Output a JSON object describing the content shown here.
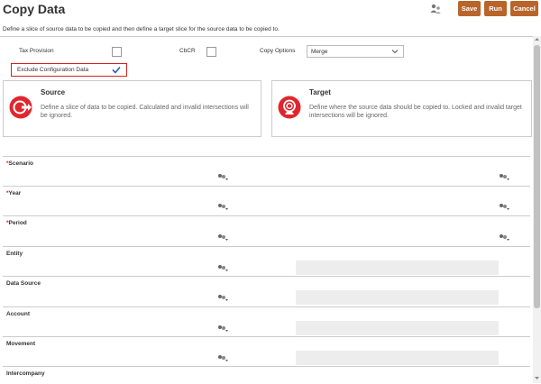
{
  "header": {
    "title": "Copy Data",
    "save_label": "Save",
    "run_label": "Run",
    "cancel_label": "Cancel"
  },
  "description": "Define a slice of source data to be copied and then define a target slice for the source data to be copied to.",
  "options": {
    "tax_provision_label": "Tax Provision",
    "tax_provision_checked": false,
    "cbcr_label": "CbCR",
    "cbcr_checked": false,
    "copy_options_label": "Copy Options",
    "copy_options_value": "Merge",
    "exclude_config_label": "Exclude Configuration Data",
    "exclude_config_checked": true
  },
  "source": {
    "title": "Source",
    "text": "Define a slice of data to be copied. Calculated and invalid intersections will be ignored."
  },
  "target": {
    "title": "Target",
    "text": "Define where the source data should be copied to. Locked and invalid target intersections will be ignored."
  },
  "dimensions": [
    {
      "label": "Scenario",
      "required": true
    },
    {
      "label": "Year",
      "required": true
    },
    {
      "label": "Period",
      "required": true
    },
    {
      "label": "Entity",
      "required": false
    },
    {
      "label": "Data Source",
      "required": false
    },
    {
      "label": "Account",
      "required": false
    },
    {
      "label": "Movement",
      "required": false
    },
    {
      "label": "Intercompany",
      "required": false
    }
  ],
  "colors": {
    "button": "#b8642a",
    "highlight_border": "#d32222",
    "icon_red": "#e0262d"
  },
  "icons": {
    "header": "people-icon",
    "member_selector": "member-selector-icon",
    "source": "source-icon",
    "target": "target-icon"
  }
}
